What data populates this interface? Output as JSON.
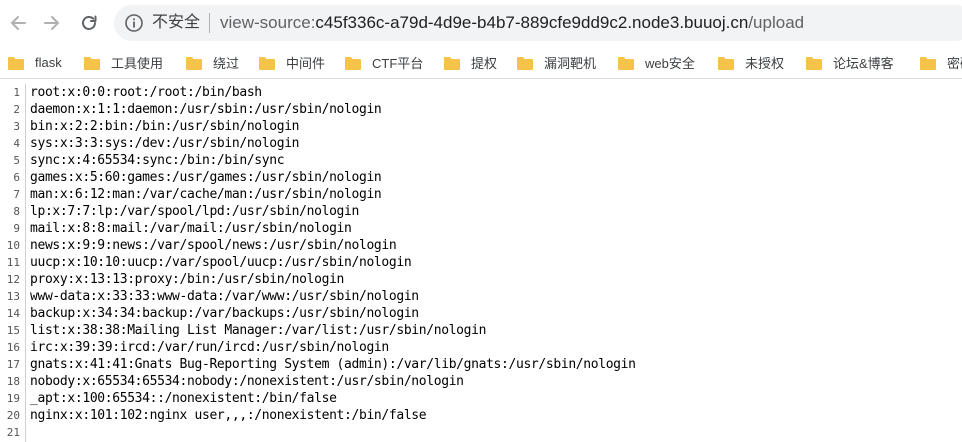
{
  "browser": {
    "security_label": "不安全",
    "url": {
      "scheme": "view-source:",
      "host": "c45f336c-a79d-4d9e-b4b7-889cfe9dd9c2.node3.buuoj.cn",
      "path": "/upload"
    },
    "nav_icons": [
      "back-arrow-icon",
      "forward-arrow-icon",
      "reload-icon",
      "info-icon"
    ]
  },
  "bookmarks": [
    {
      "label": "flask"
    },
    {
      "label": "工具使用"
    },
    {
      "label": "绕过"
    },
    {
      "label": "中间件"
    },
    {
      "label": "CTF平台"
    },
    {
      "label": "提权"
    },
    {
      "label": "漏洞靶机"
    },
    {
      "label": "web安全"
    },
    {
      "label": "未授权"
    },
    {
      "label": "论坛&博客"
    },
    {
      "label": "密码"
    }
  ],
  "colors": {
    "folder": "#f6c34a",
    "line_number": "#555555",
    "omnibox_bg": "#f1f3f4"
  },
  "source_lines": [
    {
      "n": "1",
      "text": "root:x:0:0:root:/root:/bin/bash"
    },
    {
      "n": "2",
      "text": "daemon:x:1:1:daemon:/usr/sbin:/usr/sbin/nologin"
    },
    {
      "n": "3",
      "text": "bin:x:2:2:bin:/bin:/usr/sbin/nologin"
    },
    {
      "n": "4",
      "text": "sys:x:3:3:sys:/dev:/usr/sbin/nologin"
    },
    {
      "n": "5",
      "text": "sync:x:4:65534:sync:/bin:/bin/sync"
    },
    {
      "n": "6",
      "text": "games:x:5:60:games:/usr/games:/usr/sbin/nologin"
    },
    {
      "n": "7",
      "text": "man:x:6:12:man:/var/cache/man:/usr/sbin/nologin"
    },
    {
      "n": "8",
      "text": "lp:x:7:7:lp:/var/spool/lpd:/usr/sbin/nologin"
    },
    {
      "n": "9",
      "text": "mail:x:8:8:mail:/var/mail:/usr/sbin/nologin"
    },
    {
      "n": "10",
      "text": "news:x:9:9:news:/var/spool/news:/usr/sbin/nologin"
    },
    {
      "n": "11",
      "text": "uucp:x:10:10:uucp:/var/spool/uucp:/usr/sbin/nologin"
    },
    {
      "n": "12",
      "text": "proxy:x:13:13:proxy:/bin:/usr/sbin/nologin"
    },
    {
      "n": "13",
      "text": "www-data:x:33:33:www-data:/var/www:/usr/sbin/nologin"
    },
    {
      "n": "14",
      "text": "backup:x:34:34:backup:/var/backups:/usr/sbin/nologin"
    },
    {
      "n": "15",
      "text": "list:x:38:38:Mailing List Manager:/var/list:/usr/sbin/nologin"
    },
    {
      "n": "16",
      "text": "irc:x:39:39:ircd:/var/run/ircd:/usr/sbin/nologin"
    },
    {
      "n": "17",
      "text": "gnats:x:41:41:Gnats Bug-Reporting System (admin):/var/lib/gnats:/usr/sbin/nologin"
    },
    {
      "n": "18",
      "text": "nobody:x:65534:65534:nobody:/nonexistent:/usr/sbin/nologin"
    },
    {
      "n": "19",
      "text": "_apt:x:100:65534::/nonexistent:/bin/false"
    },
    {
      "n": "20",
      "text": "nginx:x:101:102:nginx user,,,:/nonexistent:/bin/false"
    },
    {
      "n": "21",
      "text": ""
    }
  ]
}
